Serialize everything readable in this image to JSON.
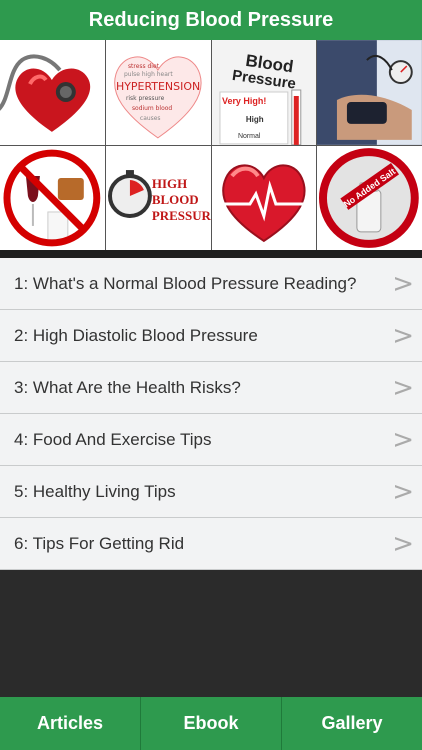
{
  "app": {
    "title": "Reducing Blood Pressure"
  },
  "gallery": {
    "tiles": [
      {
        "icon": "heart-stethoscope-icon"
      },
      {
        "icon": "hypertension-heart-wordcloud-icon",
        "text": "HYPERTENSION"
      },
      {
        "icon": "blood-pressure-thermometer-icon",
        "text": [
          "Blood",
          "Pressure",
          "Very High!",
          "High",
          "Normal"
        ]
      },
      {
        "icon": "blood-pressure-cuff-icon"
      },
      {
        "icon": "no-alcohol-icon"
      },
      {
        "icon": "stopwatch-high-bp-icon",
        "text": [
          "HIGH",
          "BLOOD",
          "PRESSUR"
        ]
      },
      {
        "icon": "heart-ecg-icon"
      },
      {
        "icon": "no-added-salt-icon",
        "text": "No Added Salt"
      }
    ]
  },
  "articles": [
    "1: What's a Normal Blood Pressure Reading?",
    "2: High Diastolic Blood Pressure",
    "3: What Are the Health Risks?",
    "4: Food And Exercise Tips",
    "5: Healthy Living Tips",
    "6: Tips For Getting Rid"
  ],
  "tabs": [
    "Articles",
    "Ebook",
    "Gallery"
  ],
  "colors": {
    "header": "#2e9a4e",
    "tabbar": "#2e9a4e",
    "list_bg": "#f2f3f4",
    "background": "#2b2b2b"
  }
}
